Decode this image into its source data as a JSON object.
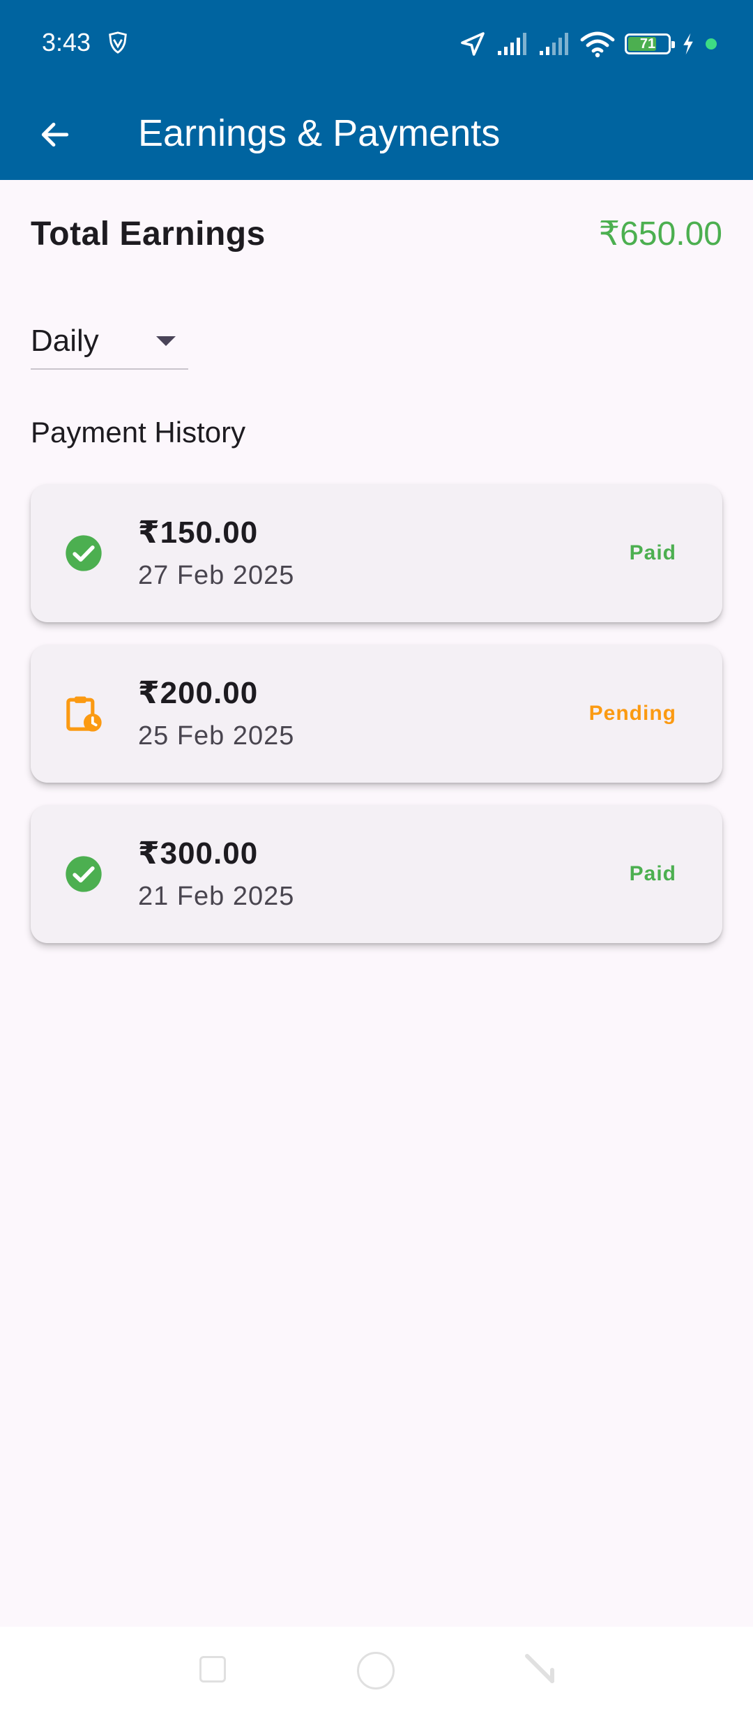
{
  "status_bar": {
    "time": "3:43",
    "battery_level": "71",
    "battery_fraction": 0.71
  },
  "app_bar": {
    "title": "Earnings & Payments",
    "back_icon": "arrow-left-icon"
  },
  "summary": {
    "label": "Total Earnings",
    "value": "₹650.00"
  },
  "filter": {
    "selected": "Daily"
  },
  "history": {
    "title": "Payment History",
    "payments": [
      {
        "amount": "₹150.00",
        "date": "27 Feb 2025",
        "status": "Paid",
        "icon": "check-circle-icon",
        "color": "#4caf50"
      },
      {
        "amount": "₹200.00",
        "date": "25 Feb 2025",
        "status": "Pending",
        "icon": "pending-clipboard-icon",
        "color": "#fb9a12"
      },
      {
        "amount": "₹300.00",
        "date": "21 Feb 2025",
        "status": "Paid",
        "icon": "check-circle-icon",
        "color": "#4caf50"
      }
    ]
  },
  "colors": {
    "primary": "#0064a0",
    "success": "#4caf50",
    "pending": "#fb9a12"
  }
}
